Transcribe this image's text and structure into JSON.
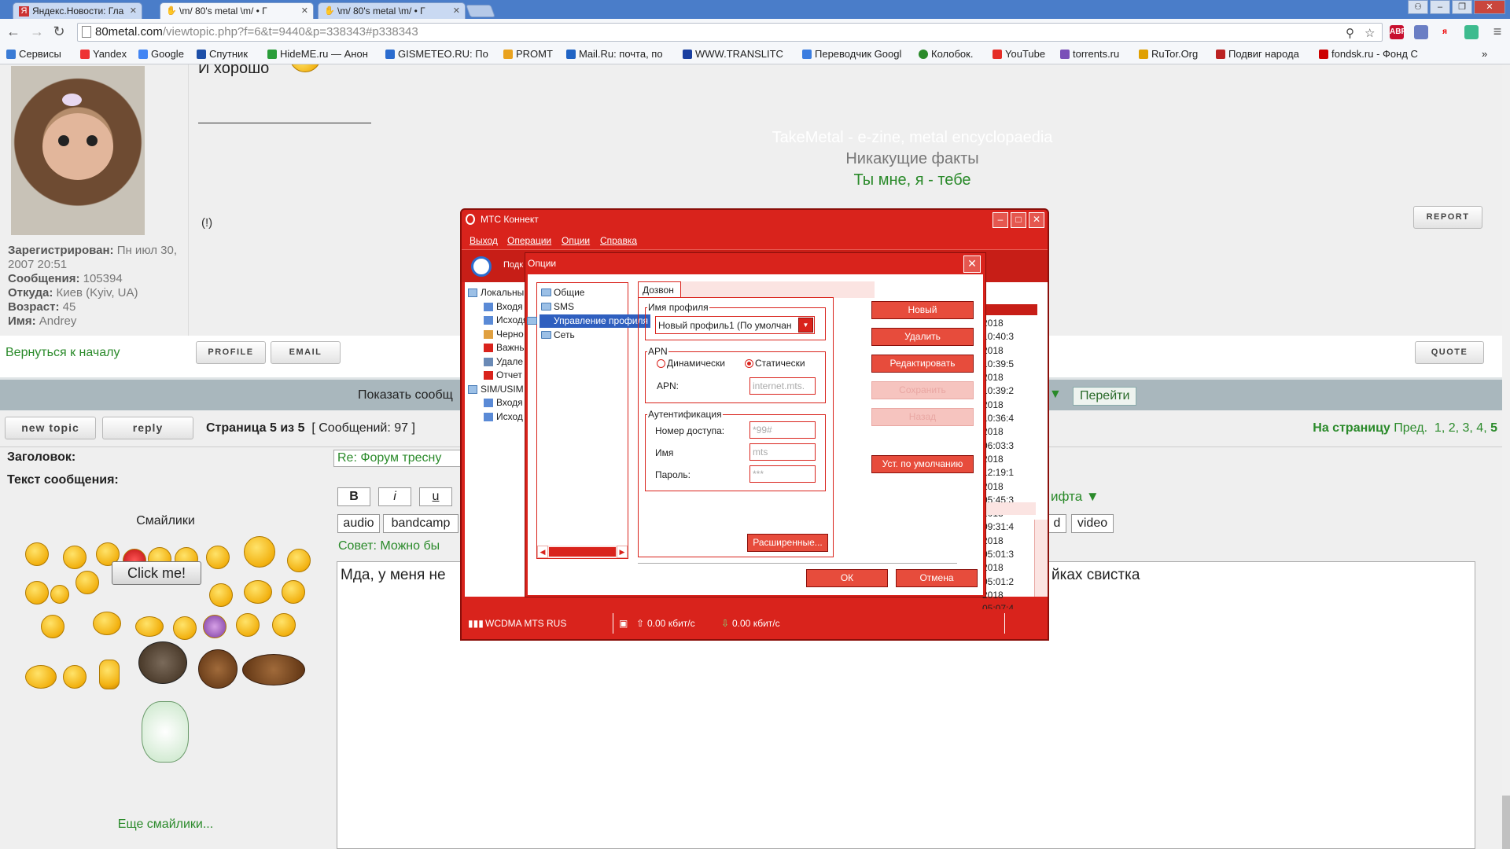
{
  "browser": {
    "tabs": [
      {
        "title": "Яндекс.Новости: Гла",
        "icon": "yandex-news-icon",
        "active": false
      },
      {
        "title": "\\m/ 80's metal \\m/ • Г",
        "icon": "hand-metal-icon",
        "active": true
      },
      {
        "title": "\\m/ 80's metal \\m/ • Г",
        "icon": "hand-metal-icon",
        "active": false
      }
    ],
    "tab_close": "✕",
    "url_host": "80metal.com",
    "url_path": "/viewtopic.php?f=6&t=9440&p=338343#p338343",
    "bookmarks": [
      {
        "label": "Сервисы",
        "color": "#3a7bd5"
      },
      {
        "label": "Yandex",
        "color": "#e33"
      },
      {
        "label": "Google",
        "color": "#4285f4"
      },
      {
        "label": "Спутник",
        "color": "#1d4fa8"
      },
      {
        "label": "HideME.ru — Анон",
        "color": "#2a9d3a"
      },
      {
        "label": "GISMETEO.RU: По",
        "color": "#2b6ccf"
      },
      {
        "label": "PROMT",
        "color": "#e9a21e"
      },
      {
        "label": "Mail.Ru: почта, по",
        "color": "#1f63c4"
      },
      {
        "label": "WWW.TRANSLITC",
        "color": "#1a3fa0"
      },
      {
        "label": "Переводчик Googl",
        "color": "#3b7de0"
      },
      {
        "label": "Колобок.",
        "color": "#2a8a2a"
      },
      {
        "label": "YouTube",
        "color": "#e52d27"
      },
      {
        "label": "torrents.ru",
        "color": "#7a4fb8"
      },
      {
        "label": "RuTor.Org",
        "color": "#e0a000"
      },
      {
        "label": "Подвиг народа",
        "color": "#b22"
      },
      {
        "label": "fondsk.ru - Фонд С",
        "color": "#c00"
      }
    ],
    "extensions": [
      {
        "label": "ABP",
        "color": "#c8102e"
      },
      {
        "label": "",
        "color": "#6a7ec4"
      },
      {
        "label": "я",
        "color": "#ffffff"
      },
      {
        "label": "",
        "color": "#3dbb8e"
      }
    ]
  },
  "post": {
    "text": "И хорошо",
    "sig_line1": "TakeMetal - e-zine, metal encyclopaedia",
    "sig_line2": "Никакущие факты",
    "sig_line3": "Ты мне, я - тебе",
    "excl": "(!)",
    "author": {
      "registered_label": "Зарегистрирован:",
      "registered_value": "Пн июл 30, 2007 20:51",
      "posts_label": "Сообщения:",
      "posts_value": "105394",
      "from_label": "Откуда:",
      "from_value": "Киев (Kyiv, UA)",
      "age_label": "Возраст:",
      "age_value": "45",
      "name_label": "Имя:",
      "name_value": "Andrey"
    },
    "report": "REPORT",
    "profile": "PROFILE",
    "email": "EMAIL",
    "quote": "QUOTE",
    "back_to_top": "Вернуться к началу"
  },
  "jump": {
    "show_label": "Показать сообщ",
    "arrow": "▼",
    "go_label": "Перейти"
  },
  "pagination": {
    "new_topic": "new topic",
    "reply": "reply",
    "page_prefix": "Страница",
    "page_current": "5",
    "page_of": "из",
    "page_total": "5",
    "messages": "[ Сообщений: 97 ]",
    "nav_label": "На страницу",
    "prev": "Пред.",
    "pages": [
      "1",
      "2",
      "3",
      "4",
      "5"
    ]
  },
  "form": {
    "subject_label": "Заголовок:",
    "subject_value": "Re: Форум тресну",
    "text_label": "Текст сообщения:",
    "smilies_title": "Смайлики",
    "click_me": "Click me!",
    "more_smilies": "Еще смайлики...",
    "fmt_buttons": [
      "B",
      "i",
      "u"
    ],
    "tag_buttons": [
      "audio",
      "bandcamp"
    ],
    "right_tags": [
      "d",
      "video"
    ],
    "font_dropdown": "ифта",
    "tip": "Совет: Можно бы",
    "message_start": "Мда, у меня не",
    "message_end": "йках свистка"
  },
  "mts": {
    "title": "МТС Коннект",
    "menu": [
      "Выход",
      "Операции",
      "Опции",
      "Справка"
    ],
    "toolbar_label": "Подк",
    "tree": [
      {
        "label": "Локальны",
        "level": 1
      },
      {
        "label": "Входя",
        "level": 2
      },
      {
        "label": "Исходя",
        "level": 2
      },
      {
        "label": "Черно",
        "level": 2
      },
      {
        "label": "Важны",
        "level": 2
      },
      {
        "label": "Удале",
        "level": 2
      },
      {
        "label": "Отчет",
        "level": 2
      },
      {
        "label": "SIM/USIM",
        "level": 1
      },
      {
        "label": "Входя",
        "level": 2
      },
      {
        "label": "Исход",
        "level": 2
      }
    ],
    "log": [
      "2018 10:40:3",
      "2018 10:39:5",
      "2018 10:39:2",
      "2018 10:36:4",
      "2018 06:03:3",
      "2018 12:19:1",
      "2018 05:45:3",
      "2018 09:31:4",
      "2018 05:01:3",
      "2018 05:01:2",
      "2018 05:07:4"
    ],
    "status_network": "WCDMA MTS RUS",
    "status_up": "0.00 кбит/с",
    "status_down": "0.00 кбит/с"
  },
  "options": {
    "title": "Опции",
    "tree": [
      "Общие",
      "SMS",
      "Управление профиля",
      "Сеть"
    ],
    "selected_tree_item": "Управление профиля",
    "tab": "Дозвон",
    "profile_group": "Имя профиля",
    "profile_value": "Новый профиль1 (По умолчан",
    "apn_group": "APN",
    "radio_dynamic": "Динамически",
    "radio_static": "Статически",
    "radio_selected": "static",
    "apn_label": "APN:",
    "apn_value": "internet.mts.",
    "auth_group": "Аутентификация",
    "access_label": "Номер доступа:",
    "access_value": "*99#",
    "name_label": "Имя",
    "name_value": "mts",
    "password_label": "Пароль:",
    "password_value": "***",
    "advanced": "Расширенные...",
    "btn_new": "Новый",
    "btn_delete": "Удалить",
    "btn_edit": "Редактировать",
    "btn_save": "Сохранить",
    "btn_back": "Назад",
    "btn_default": "Уст. по умолчанию",
    "ok": "ОК",
    "cancel": "Отмена"
  }
}
